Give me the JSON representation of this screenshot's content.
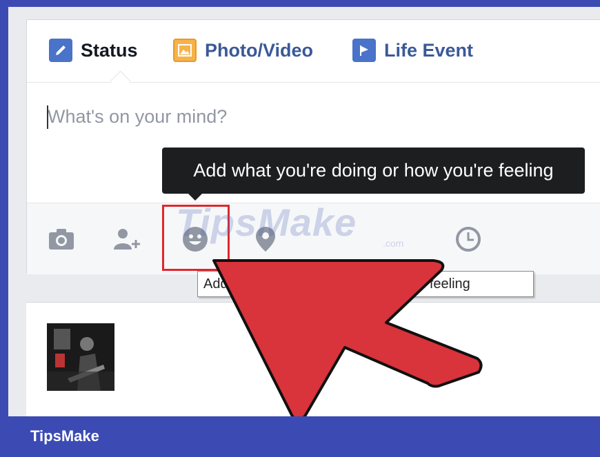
{
  "composer": {
    "tabs": [
      {
        "label": "Status"
      },
      {
        "label": "Photo/Video"
      },
      {
        "label": "Life Event"
      }
    ],
    "input": {
      "placeholder": "What's on your mind?",
      "value": ""
    },
    "tooltip_dark": "Add what you're doing or how you're feeling",
    "tooltip_light": "Add what you're doing or how you're feeling",
    "actions": [
      {
        "icon": "camera-icon"
      },
      {
        "icon": "tag-people-icon"
      },
      {
        "icon": "feeling-smiley-icon"
      },
      {
        "icon": "location-pin-icon"
      },
      {
        "icon": "clock-icon"
      }
    ]
  },
  "watermark": {
    "text": "TipsMake",
    "suffix": ".com"
  },
  "footer": {
    "brand": "TipsMake"
  },
  "colors": {
    "frame": "#3c4bb4",
    "link": "#3b5998",
    "highlight": "#e0262c",
    "arrow": "#d9333b"
  }
}
